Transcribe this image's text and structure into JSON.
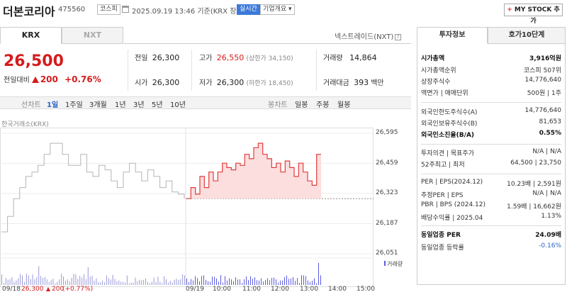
{
  "header": {
    "stock_name": "더본코리아",
    "stock_code": "475560",
    "market_badge": "코스피",
    "date_text": "2025.09.19 13:46 기준(KRX 장중)",
    "realtime_badge": "실시간",
    "company_info_button": "기업개요",
    "my_stock_plus": "+",
    "my_stock_label": "MY STOCK 추가"
  },
  "market_tabs": [
    "KRX",
    "NXT"
  ],
  "nxt_link": "넥스트레이드(NXT)",
  "help_glyph": "?",
  "quote": {
    "price": "26,500",
    "change_label": "전일대비",
    "change_value": "200",
    "change_pct": "+0.76%",
    "prev_close_label": "전일",
    "prev_close": "26,300",
    "high_label": "고가",
    "high": "26,550",
    "upper_limit": "(상한가 34,150)",
    "volume_label": "거래량",
    "volume": "14,864",
    "open_label": "시가",
    "open": "26,300",
    "low_label": "저가",
    "low": "26,300",
    "lower_limit": "(하한가 18,450)",
    "amount_label": "거래대금",
    "amount": "393",
    "amount_unit": "백만"
  },
  "period_tabs": {
    "line_label": "선차트",
    "periods": [
      "1일",
      "1주일",
      "3개월",
      "1년",
      "3년",
      "5년",
      "10년"
    ],
    "candle_label": "봉차트",
    "candles": [
      "일봉",
      "주봉",
      "월봉"
    ]
  },
  "chart_data": {
    "type": "line",
    "exchange_label": "한국거래소(KRX)",
    "y_ticks": [
      "26,595",
      "26,459",
      "26,323",
      "26,187",
      "26,051"
    ],
    "ylim": [
      26051,
      26595
    ],
    "prev_close": 26300,
    "volume_label": "거래량",
    "x_ticks": [
      "09/19",
      "10:00",
      "11:00",
      "12:00",
      "13:00",
      "14:00",
      "15:00"
    ],
    "prev_day": {
      "label": "09/18",
      "close": "26,300",
      "change": "200",
      "pct": "(+0.77%)",
      "values": [
        26150,
        26220,
        26300,
        26350,
        26400,
        26420,
        26450,
        26500,
        26550,
        26550,
        26500,
        26450,
        26450,
        26500,
        26420,
        26400,
        26450,
        26430,
        26380,
        26350,
        26420,
        26460,
        26420,
        26380,
        26430,
        26400,
        26350,
        26380,
        26330,
        26320,
        26300
      ]
    },
    "today": {
      "values": [
        26300,
        26350,
        26320,
        26400,
        26350,
        26420,
        26380,
        26420,
        26460,
        26440,
        26430,
        26460,
        26450,
        26500,
        26480,
        26530,
        26550,
        26500,
        26480,
        26440,
        26460,
        26420,
        26470,
        26440,
        26400,
        26460,
        26420,
        26380,
        26360,
        26500,
        26500
      ]
    }
  },
  "side_panel": {
    "tabs": [
      "투자정보",
      "호가10단계"
    ],
    "rows": [
      {
        "k": "시가총액",
        "v": "3,916억원",
        "bold": true
      },
      {
        "k": "시가총액순위",
        "v": "코스피 507위"
      },
      {
        "k": "상장주식수",
        "v": "14,776,640"
      },
      {
        "k": "액면가 | 매매단위",
        "v": "500원 | 1주"
      },
      {
        "k": "외국인한도주식수(A)",
        "v": "14,776,640"
      },
      {
        "k": "외국인보유주식수(B)",
        "v": "81,653"
      },
      {
        "k": "외국인소진율(B/A)",
        "v": "0.55%",
        "bold": true
      },
      {
        "k": "투자의견 | 목표주가",
        "v": "N/A | N/A"
      },
      {
        "k": "52주최고 | 최저",
        "v": "64,500 | 23,750"
      },
      {
        "k": "PER | EPS(2024.12)",
        "v": "10.23배 | 2,591원"
      },
      {
        "k": "추정PER | EPS",
        "v": "N/A | N/A"
      },
      {
        "k": "PBR | BPS (2024.12)",
        "v": "1.59배 | 16,662원"
      },
      {
        "k": "배당수익률 | 2025.04",
        "v": "1.13%"
      },
      {
        "k": "동일업종 PER",
        "v": "24.09배",
        "bold": true
      },
      {
        "k": "동일업종 등락률",
        "v": "-0.16%",
        "blue": true
      }
    ]
  }
}
